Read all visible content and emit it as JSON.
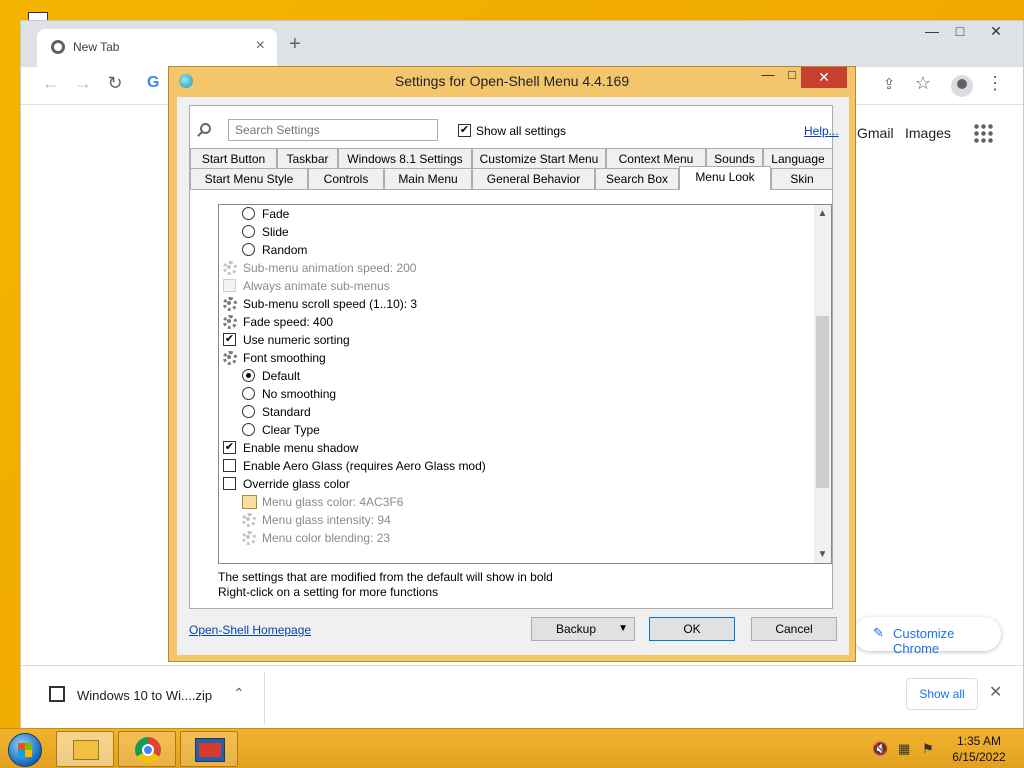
{
  "chrome": {
    "tab_title": "New Tab",
    "tab_close": "×",
    "new_tab": "+",
    "win_min": "—",
    "win_max": "□",
    "win_close": "✕",
    "links": [
      "Gmail",
      "Images"
    ],
    "customize": "Customize Chrome",
    "customize_icon": "✎",
    "download_file": "Windows 10 to Wi....zip",
    "show_all": "Show all",
    "icons": [
      "back-arrow-icon",
      "forward-arrow-icon",
      "reload-icon",
      "google-icon",
      "share-icon",
      "star-icon",
      "profile-icon",
      "menu-dots-icon",
      "apps-grid-icon",
      "zip-file-icon",
      "chevron-up-icon",
      "close-icon"
    ]
  },
  "dialog": {
    "title": "Settings for Open-Shell Menu 4.4.169",
    "search_placeholder": "Search Settings",
    "show_all_settings": "Show all settings",
    "show_all_checked": true,
    "help": "Help...",
    "tabs_row1": [
      "Start Button",
      "Taskbar",
      "Windows 8.1 Settings",
      "Customize Start Menu",
      "Context Menu",
      "Sounds",
      "Language"
    ],
    "tabs_row2": [
      "Start Menu Style",
      "Controls",
      "Main Menu",
      "General Behavior",
      "Search Box",
      "Menu Look",
      "Skin"
    ],
    "active_tab": "Menu Look",
    "settings": [
      {
        "kind": "radio",
        "label": "Fade",
        "indent": 1,
        "on": false
      },
      {
        "kind": "radio",
        "label": "Slide",
        "indent": 1,
        "on": false
      },
      {
        "kind": "radio",
        "label": "Random",
        "indent": 1,
        "on": false
      },
      {
        "kind": "gear",
        "label": "Sub-menu animation speed: 200",
        "indent": 0,
        "dim": true
      },
      {
        "kind": "check",
        "label": "Always animate sub-menus",
        "indent": 0,
        "dim": true,
        "on": false
      },
      {
        "kind": "gear",
        "label": "Sub-menu scroll speed (1..10): 3",
        "indent": 0
      },
      {
        "kind": "gear",
        "label": "Fade speed: 400",
        "indent": 0
      },
      {
        "kind": "check",
        "label": "Use numeric sorting",
        "indent": 0,
        "on": true
      },
      {
        "kind": "gear",
        "label": "Font smoothing",
        "indent": 0
      },
      {
        "kind": "radio",
        "label": "Default",
        "indent": 1,
        "on": true
      },
      {
        "kind": "radio",
        "label": "No smoothing",
        "indent": 1,
        "on": false
      },
      {
        "kind": "radio",
        "label": "Standard",
        "indent": 1,
        "on": false
      },
      {
        "kind": "radio",
        "label": "Clear Type",
        "indent": 1,
        "on": false
      },
      {
        "kind": "check",
        "label": "Enable menu shadow",
        "indent": 0,
        "on": true
      },
      {
        "kind": "check",
        "label": "Enable Aero Glass (requires Aero Glass mod)",
        "indent": 0,
        "on": false
      },
      {
        "kind": "check",
        "label": "Override glass color",
        "indent": 0,
        "on": false
      },
      {
        "kind": "swatch",
        "label": "Menu glass color: 4AC3F6",
        "indent": 1,
        "dim": true,
        "color": "#f8dea0"
      },
      {
        "kind": "gear",
        "label": "Menu glass intensity: 94",
        "indent": 1,
        "dim": true
      },
      {
        "kind": "gear",
        "label": "Menu color blending: 23",
        "indent": 1,
        "dim": true
      }
    ],
    "scroll_position": 0.62,
    "note_line1": "The settings that are modified from the default will show in bold",
    "note_line2": "Right-click on a setting for more functions",
    "homepage_link": "Open-Shell Homepage",
    "backup": "Backup",
    "ok": "OK",
    "cancel": "Cancel"
  },
  "taskbar": {
    "time": "1:35 AM",
    "date": "6/15/2022",
    "tray_icons": [
      "volume-muted-icon",
      "network-icon",
      "action-center-flag-icon"
    ]
  }
}
